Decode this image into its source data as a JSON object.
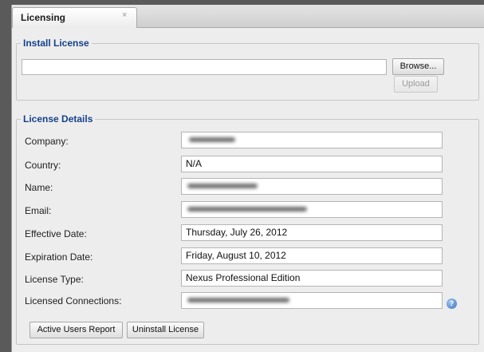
{
  "tab": {
    "title": "Licensing",
    "close_glyph": "×"
  },
  "install": {
    "legend": "Install License",
    "file_value": "",
    "browse_label": "Browse...",
    "upload_label": "Upload"
  },
  "details": {
    "legend": "License Details",
    "rows": [
      {
        "label": "Company:",
        "value": ""
      },
      {
        "label": "Country:",
        "value": "N/A"
      },
      {
        "label": "Name:",
        "value": ""
      },
      {
        "label": "Email:",
        "value": ""
      },
      {
        "label": "Effective Date:",
        "value": "Thursday, July 26, 2012"
      },
      {
        "label": "Expiration Date:",
        "value": "Friday, August 10, 2012"
      },
      {
        "label": "License Type:",
        "value": "Nexus Professional Edition"
      },
      {
        "label": "Licensed Connections:",
        "value": ""
      }
    ],
    "help_icon": "help-icon",
    "help_glyph": "?"
  },
  "actions": {
    "report_label": "Active Users Report",
    "uninstall_label": "Uninstall License"
  },
  "colors": {
    "legend": "#15428b",
    "help_icon": "#3a76c2"
  }
}
